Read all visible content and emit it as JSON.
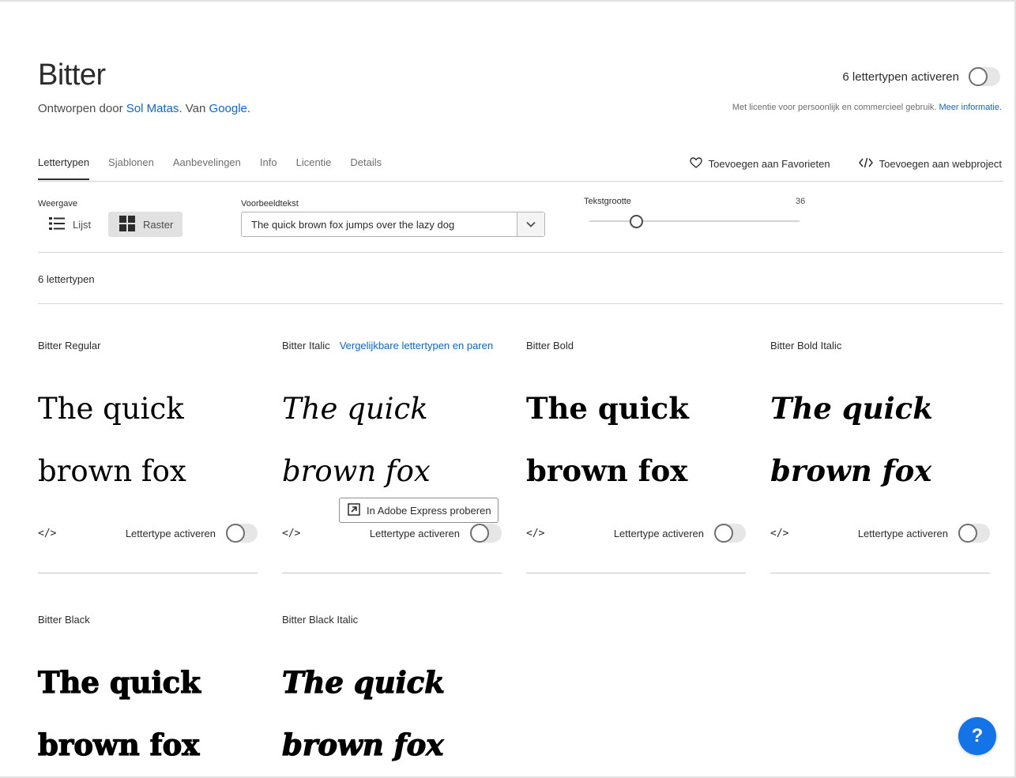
{
  "header": {
    "title": "Bitter",
    "byline_prefix": "Ontworpen door ",
    "designer": "Sol Matas",
    "byline_mid": ". Van ",
    "foundry": "Google",
    "byline_end": ".",
    "activate_all_label": "6 lettertypen activeren",
    "license_text": "Met licentie voor persoonlijk en commercieel gebruik.",
    "license_link": "Meer informatie."
  },
  "tabs": [
    {
      "label": "Lettertypen",
      "active": true
    },
    {
      "label": "Sjablonen",
      "active": false
    },
    {
      "label": "Aanbevelingen",
      "active": false
    },
    {
      "label": "Info",
      "active": false
    },
    {
      "label": "Licentie",
      "active": false
    },
    {
      "label": "Details",
      "active": false
    }
  ],
  "actions": {
    "favorites": "Toevoegen aan Favorieten",
    "webproject": "Toevoegen aan webproject"
  },
  "controls": {
    "view_label": "Weergave",
    "view_list": "Lijst",
    "view_grid": "Raster",
    "view_selected": "Raster",
    "sample_label": "Voorbeeldtekst",
    "sample_value": "The quick brown fox jumps over the lazy dog",
    "size_label": "Tekstgrootte",
    "size_value": "36",
    "size_min": 8,
    "size_max": 200
  },
  "count_label": "6 lettertypen",
  "specimen": {
    "line1": "The quick",
    "line2": "brown fox"
  },
  "fonts": [
    {
      "name": "Bitter Regular",
      "style": "regular",
      "link": "",
      "activated": false
    },
    {
      "name": "Bitter Italic",
      "style": "italic",
      "link": "Vergelijkbare lettertypen en paren",
      "activated": false
    },
    {
      "name": "Bitter Bold",
      "style": "bold",
      "link": "",
      "activated": false
    },
    {
      "name": "Bitter Bold Italic",
      "style": "bolditalic",
      "link": "",
      "activated": false
    },
    {
      "name": "Bitter Black",
      "style": "black",
      "link": "",
      "activated": false
    },
    {
      "name": "Bitter Black Italic",
      "style": "blackitalic",
      "link": "",
      "activated": false
    }
  ],
  "card_labels": {
    "embed": "</>",
    "activate": "Lettertype activeren"
  },
  "express_button": "In Adobe Express proberen",
  "help_button": "?"
}
